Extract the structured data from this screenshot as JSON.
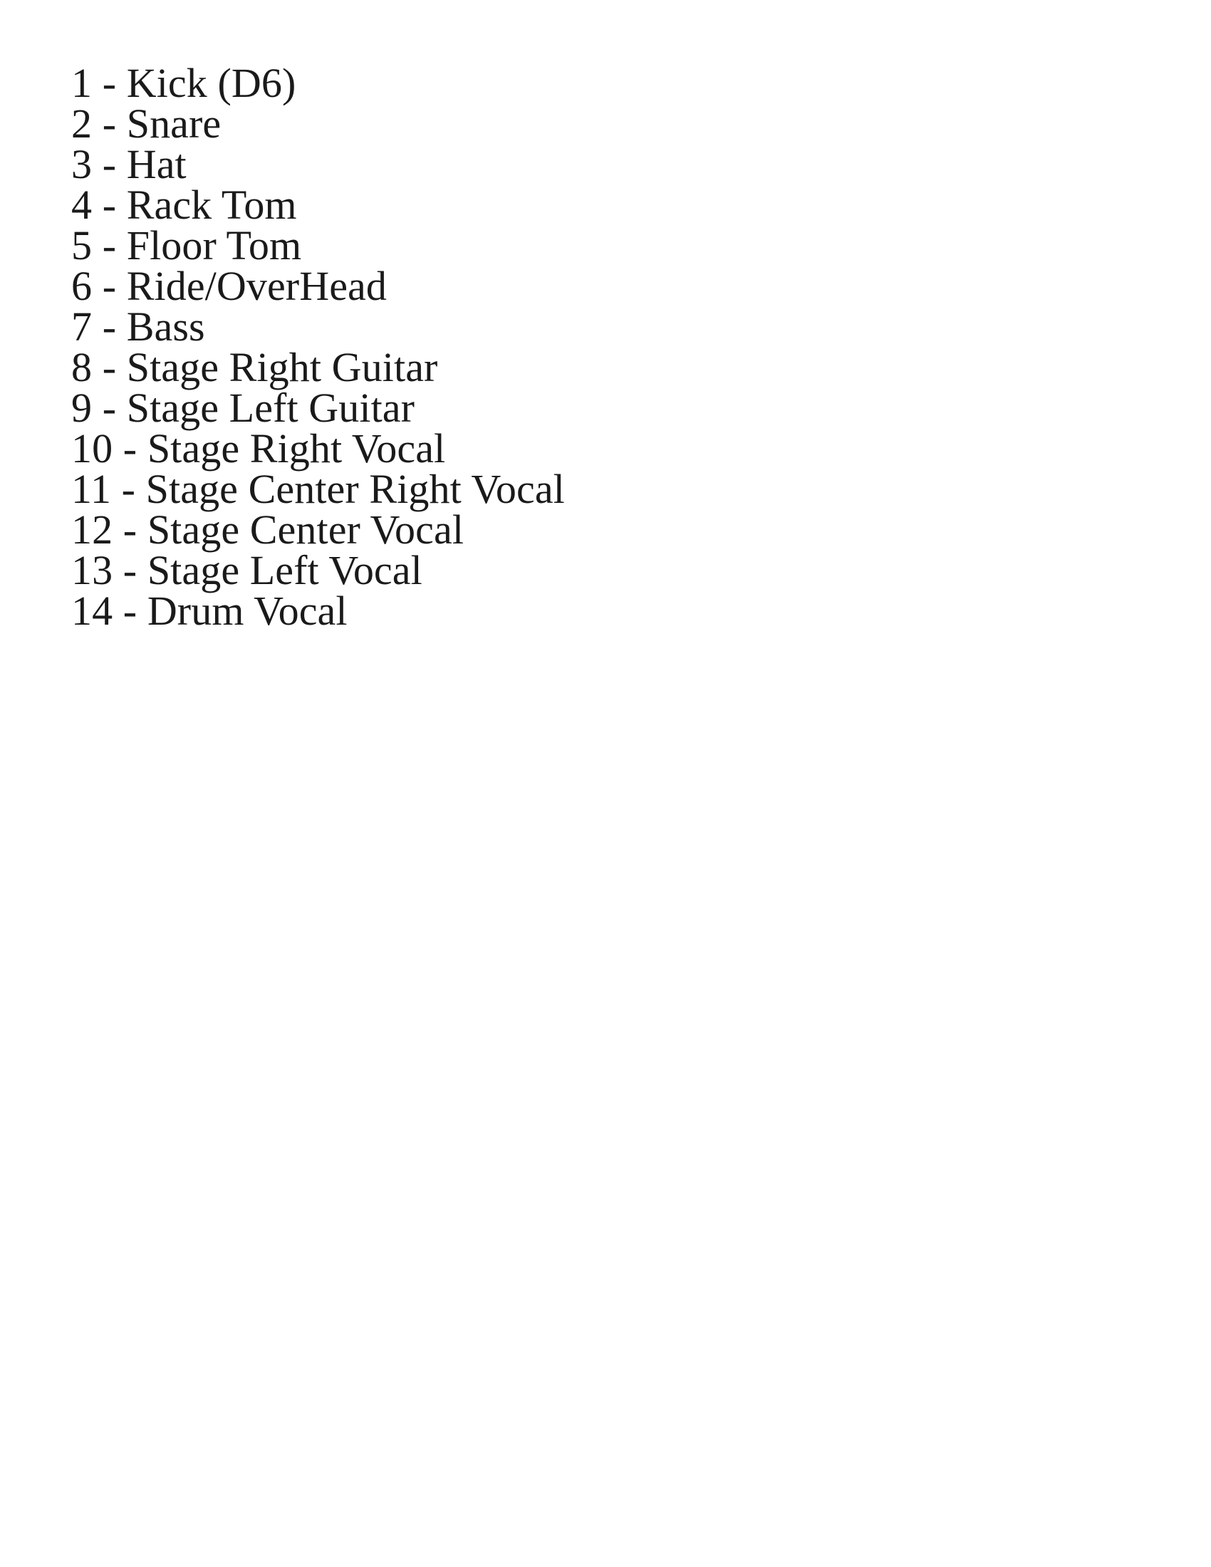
{
  "document": {
    "background_color": "#ffffff",
    "text_color": "#1a1a1a",
    "channel_list": {
      "lines": [
        {
          "text": "1 - Kick (D6)"
        },
        {
          "text": "2 - Snare"
        },
        {
          "text": "3 - Hat"
        },
        {
          "text": "4 - Rack Tom"
        },
        {
          "text": "5 - Floor Tom"
        },
        {
          "text": "6 - Ride/OverHead"
        },
        {
          "text": "7 - Bass"
        },
        {
          "text": "8 - Stage Right Guitar"
        },
        {
          "text": "9 - Stage Left Guitar"
        },
        {
          "text": "10 - Stage Right Vocal"
        },
        {
          "text": "11 - Stage Center Right Vocal"
        },
        {
          "text": "12 - Stage Center Vocal"
        },
        {
          "text": "13 - Stage Left Vocal"
        },
        {
          "text": "14 - Drum Vocal"
        }
      ]
    }
  }
}
